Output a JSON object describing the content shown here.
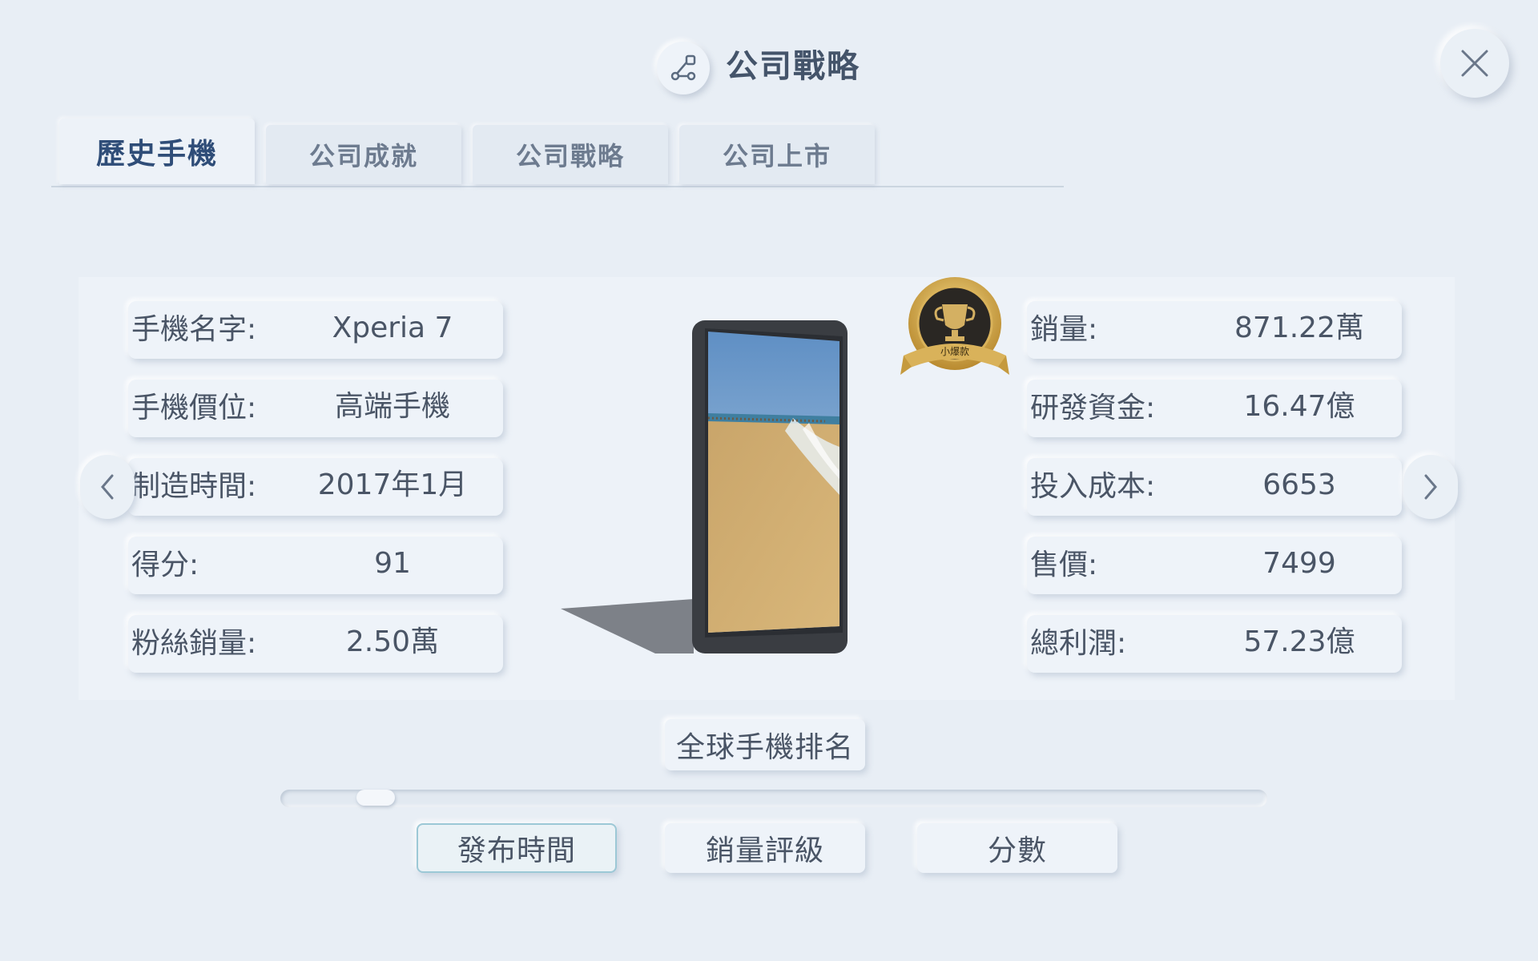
{
  "header": {
    "title": "公司戰略",
    "icon": "strategy-icon",
    "close_icon": "close-icon"
  },
  "tabs": [
    {
      "label": "歷史手機",
      "active": true
    },
    {
      "label": "公司成就",
      "active": false
    },
    {
      "label": "公司戰略",
      "active": false
    },
    {
      "label": "公司上市",
      "active": false
    }
  ],
  "phone": {
    "left_fields": [
      {
        "label": "手機名字:",
        "value": "Xperia 7"
      },
      {
        "label": "手機價位:",
        "value": "高端手機"
      },
      {
        "label": "制造時間:",
        "value": "2017年1月"
      },
      {
        "label": "得分:",
        "value": "91"
      },
      {
        "label": "粉絲銷量:",
        "value": "2.50萬"
      }
    ],
    "right_fields": [
      {
        "label": "銷量:",
        "value": "871.22萬"
      },
      {
        "label": "研發資金:",
        "value": "16.47億"
      },
      {
        "label": "投入成本:",
        "value": "6653"
      },
      {
        "label": "售價:",
        "value": "7499"
      },
      {
        "label": "總利潤:",
        "value": "57.23億"
      }
    ],
    "badge": {
      "text": "小爆款",
      "icon": "trophy-icon",
      "color": "#c9a245"
    },
    "prev_icon": "chevron-left-icon",
    "next_icon": "chevron-right-icon"
  },
  "ranking": {
    "title": "全球手機排名",
    "slider_position": 0.08,
    "sort_buttons": [
      {
        "label": "發布時間",
        "active": true
      },
      {
        "label": "銷量評級",
        "active": false
      },
      {
        "label": "分數",
        "active": false
      }
    ]
  },
  "colors": {
    "background": "#e8eef5",
    "active_tab_text": "#2f4d78",
    "active_sort_border": "#9cc8d6"
  }
}
